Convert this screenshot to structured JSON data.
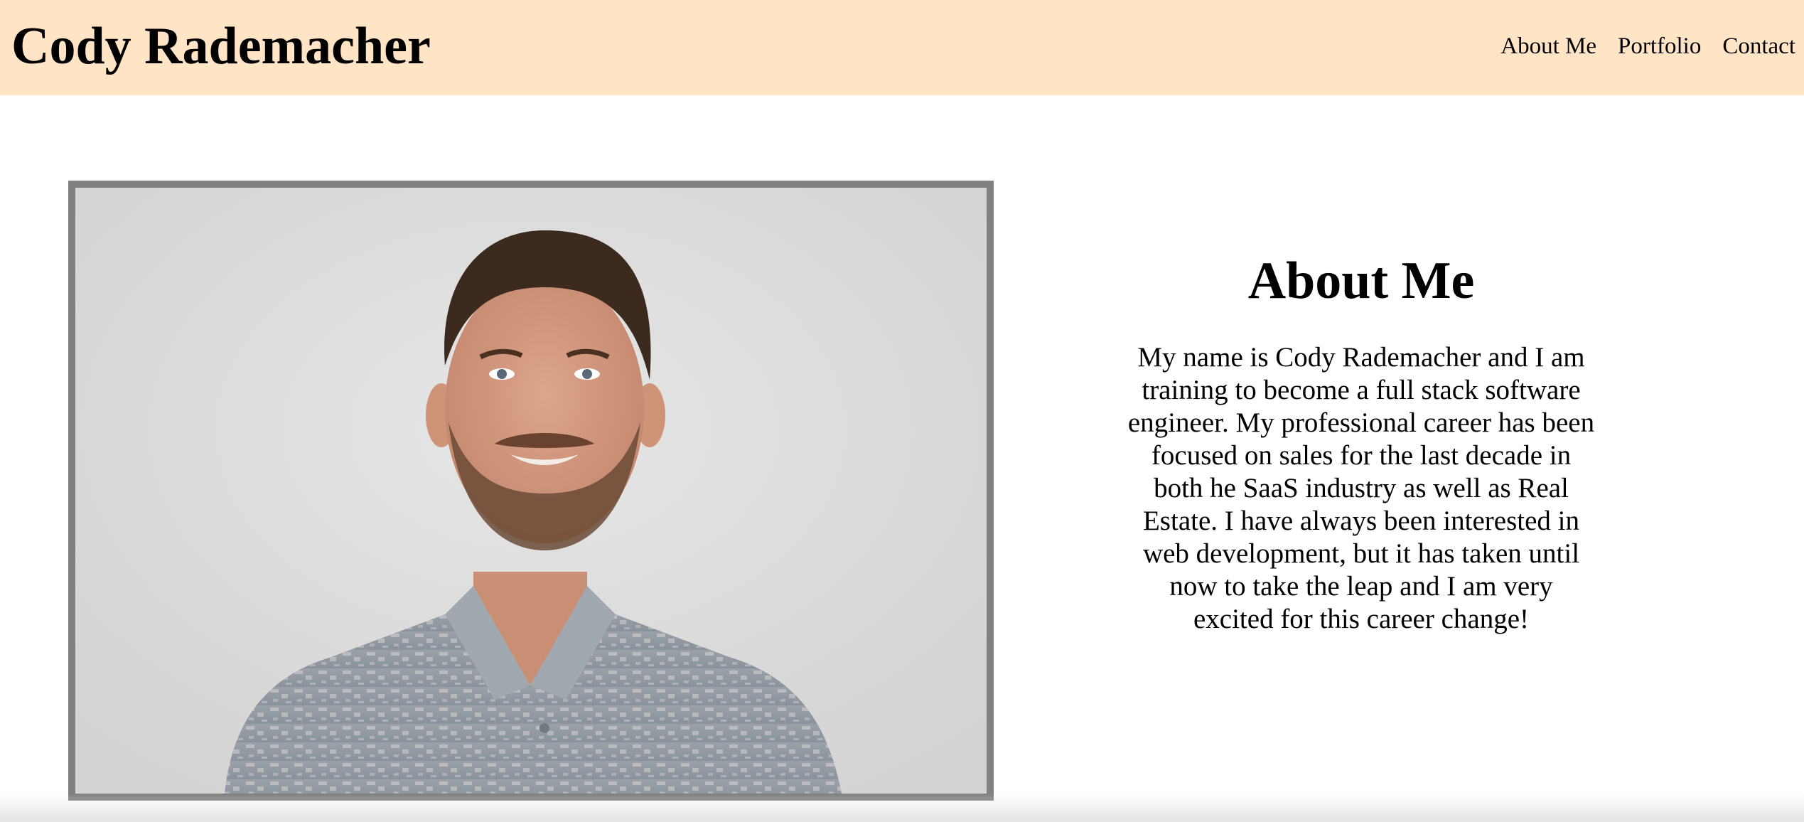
{
  "header": {
    "title": "Cody Rademacher",
    "nav": [
      "About Me",
      "Portfolio",
      "Contact"
    ]
  },
  "about": {
    "heading": "About Me",
    "body": "My name is Cody Rademacher and I am training to become a full stack software engineer. My professional career has been focused on sales for the last decade in both he SaaS industry as well as Real Estate. I have always been interested in web development, but it has taken until now to take the leap and I am very excited for this career change!"
  },
  "colors": {
    "header_bg": "#ffe4c6",
    "photo_border": "#818181",
    "page_bg": "#ffffff"
  }
}
